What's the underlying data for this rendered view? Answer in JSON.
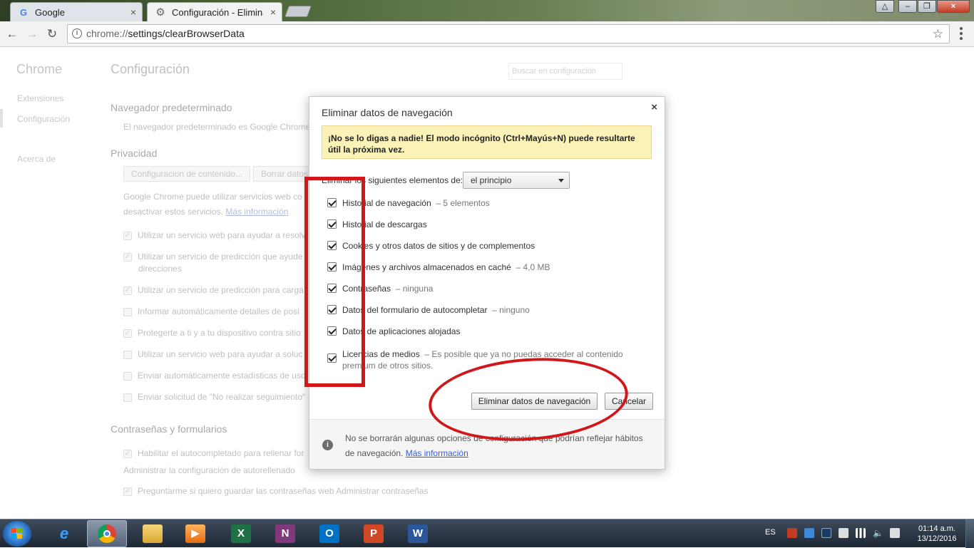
{
  "browser": {
    "tabs": [
      {
        "label": "Google",
        "icon": "google-g-icon",
        "active": false
      },
      {
        "label": "Configuración - Eliminar",
        "icon": "gear-icon",
        "active": true
      }
    ],
    "url_prefix": "chrome://",
    "url_path": "settings/clearBrowserData"
  },
  "settings_page": {
    "sidebar": {
      "title": "Chrome",
      "items": [
        "Extensiones",
        "Configuración",
        "Acerca de"
      ]
    },
    "title": "Configuración",
    "search_placeholder": "Buscar en configuración",
    "default_browser": {
      "heading": "Navegador predeterminado",
      "text": "El navegador predeterminado es Google Chrome"
    },
    "privacy": {
      "heading": "Privacidad",
      "content_settings_button": "Configuracion de contenido...",
      "clear_button": "Borrar datos",
      "text_line1": "Google Chrome puede utilizar servicios web co",
      "text_line2": "desactivar estos servicios.",
      "more_info_link": "Más información",
      "options": [
        "Utilizar un servicio web para ayudar a resolv",
        "Utilizar un servicio de predicción que ayude",
        "direcciones",
        "Utilizar un servicio de predicción para carga",
        "Informar automáticamente detalles de posi",
        "Protegerte a ti y a tu dispositivo contra sitio",
        "Utilizar un servicio web para ayudar a soluc",
        "Enviar automáticamente estadísticas de uso",
        "Enviar solicitud de \"No realizar seguimiento\""
      ]
    },
    "passwords": {
      "heading": "Contraseñas y formularios",
      "autofill_option": "Habilitar el autocompletado para rellenar for",
      "manage_autofill": "Administrar la configuración de autorellenado",
      "save_passwords_option": "Preguntarme si quiero guardar las contraseñas web  Administrar contraseñas"
    }
  },
  "dialog": {
    "title": "Eliminar datos de navegación",
    "close_label": "×",
    "warning": "¡No se lo digas a nadie! El modo incógnito (Ctrl+Mayús+N) puede resultarte útil la próxima vez.",
    "time_label": "Eliminar los siguientes elementos de:",
    "time_value": "el principio",
    "options": [
      {
        "label": "Historial de navegación",
        "detail": "–  5 elementos",
        "checked": true
      },
      {
        "label": "Historial de descargas",
        "detail": "",
        "checked": true
      },
      {
        "label": "Cookies y otros datos de sitios y de complementos",
        "detail": "",
        "checked": true
      },
      {
        "label": "Imágenes y archivos almacenados en caché",
        "detail": "–  4,0 MB",
        "checked": true
      },
      {
        "label": "Contraseñas",
        "detail": "–  ninguna",
        "checked": true
      },
      {
        "label": "Datos del formulario de autocompletar",
        "detail": "–  ninguno",
        "checked": true
      },
      {
        "label": "Datos de aplicaciones alojadas",
        "detail": "",
        "checked": true
      },
      {
        "label": "Licencias de medios",
        "detail": "–  Es posible que ya no puedas acceder al contenido premium de otros sitios.",
        "checked": true
      }
    ],
    "clear_button": "Eliminar datos de navegación",
    "cancel_button": "Cancelar",
    "footer_text": "No se borrarán algunas opciones de configuración que podrían reflejar hábitos de navegación.",
    "footer_link": "Más información"
  },
  "taskbar": {
    "apps": [
      "internet-explorer-icon",
      "chrome-icon",
      "file-explorer-icon",
      "media-player-icon",
      "excel-icon",
      "onenote-icon",
      "outlook-icon",
      "powerpoint-icon",
      "word-icon"
    ],
    "language": "ES",
    "time": "01:14 a.m.",
    "date": "13/12/2016"
  },
  "colors": {
    "annotation_red": "#d2171a",
    "warning_bg": "#fbf2b8",
    "link": "#3a5fcd"
  }
}
